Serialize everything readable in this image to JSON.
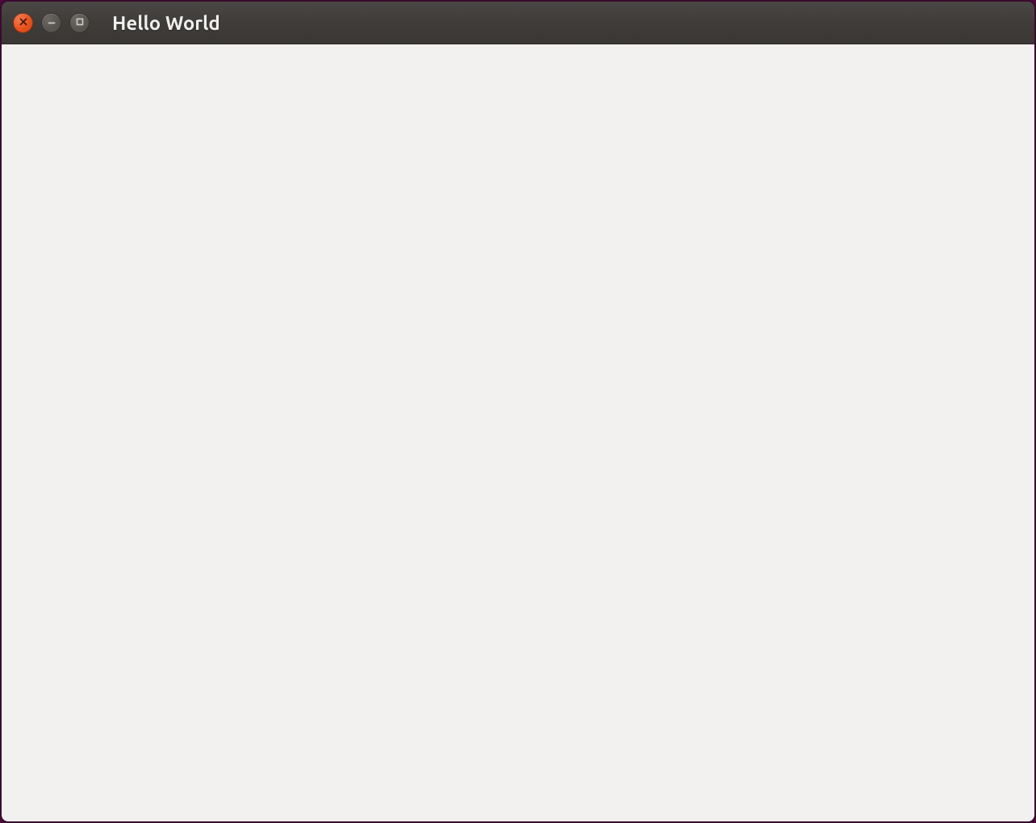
{
  "window": {
    "title": "Hello World",
    "buttons": {
      "close": "close-icon",
      "minimize": "minimize-icon",
      "maximize": "maximize-icon"
    }
  }
}
